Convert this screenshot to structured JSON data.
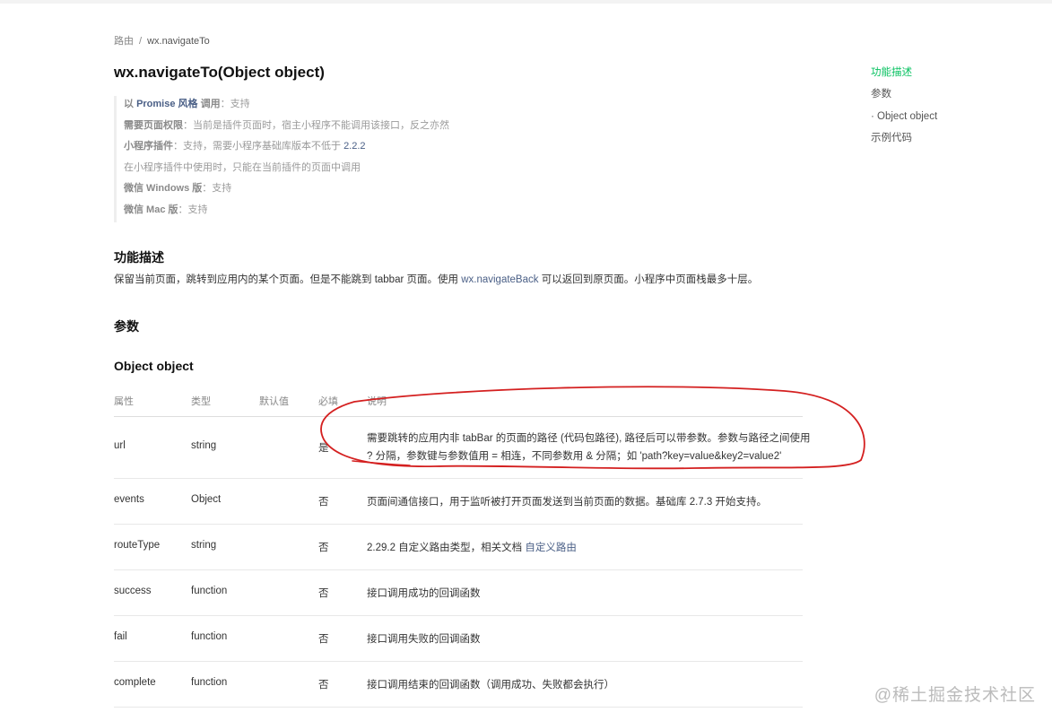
{
  "breadcrumb": {
    "root": "路由",
    "separator": "/",
    "current": "wx.navigateTo"
  },
  "title": "wx.navigateTo(Object object)",
  "meta": {
    "promise_prefix": "以",
    "promise_link": "Promise 风格",
    "promise_label": "调用",
    "promise_value": "：支持",
    "permission_label": "需要页面权限",
    "permission_value": "：当前是插件页面时，宿主小程序不能调用该接口，反之亦然",
    "plugin_label": "小程序插件",
    "plugin_value": "：支持，需要小程序基础库版本不低于",
    "plugin_version": "2.2.2",
    "plugin_note": "在小程序插件中使用时，只能在当前插件的页面中调用",
    "windows_label": "微信 Windows 版",
    "windows_value": "：支持",
    "mac_label": "微信 Mac 版",
    "mac_value": "：支持"
  },
  "section_function": {
    "heading": "功能描述",
    "text_before": "保留当前页面，跳转到应用内的某个页面。但是不能跳到 tabbar 页面。使用",
    "link": "wx.navigateBack",
    "text_after": "可以返回到原页面。小程序中页面栈最多十层。"
  },
  "section_params": {
    "heading": "参数"
  },
  "section_object": {
    "heading": "Object object"
  },
  "table": {
    "headers": [
      "属性",
      "类型",
      "默认值",
      "必填",
      "说明"
    ],
    "rows": [
      {
        "name": "url",
        "type": "string",
        "default": "",
        "required": "是",
        "desc_line1": "需要跳转的应用内非 tabBar 的页面的路径 (代码包路径), 路径后可以带参数。参数与路径之间使用",
        "desc_line2": "? 分隔，参数键与参数值用 = 相连，不同参数用 & 分隔；如 'path?key=value&key2=value2'"
      },
      {
        "name": "events",
        "type": "Object",
        "default": "",
        "required": "否",
        "desc": "页面间通信接口，用于监听被打开页面发送到当前页面的数据。基础库 2.7.3 开始支持。"
      },
      {
        "name": "routeType",
        "type": "string",
        "default": "",
        "required": "否",
        "desc": "2.29.2 自定义路由类型，相关文档",
        "link": "自定义路由"
      },
      {
        "name": "success",
        "type": "function",
        "default": "",
        "required": "否",
        "desc": "接口调用成功的回调函数"
      },
      {
        "name": "fail",
        "type": "function",
        "default": "",
        "required": "否",
        "desc": "接口调用失败的回调函数"
      },
      {
        "name": "complete",
        "type": "function",
        "default": "",
        "required": "否",
        "desc": "接口调用结束的回调函数（调用成功、失败都会执行）"
      }
    ]
  },
  "toc": [
    {
      "label": "功能描述",
      "active": true
    },
    {
      "label": "参数",
      "active": false
    },
    {
      "label": "· Object object",
      "active": false
    },
    {
      "label": "示例代码",
      "active": false
    }
  ],
  "watermark": "@稀土掘金技术社区",
  "colors": {
    "accent_green": "#07c160",
    "link_blue": "#4a5f86",
    "annotation_red": "#d42020"
  }
}
